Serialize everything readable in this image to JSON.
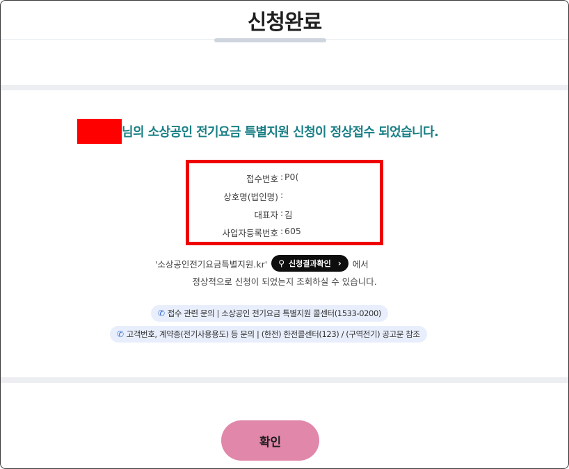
{
  "header": {
    "title": "신청완료"
  },
  "headline": {
    "text": "님의 소상공인 전기요금 특별지원 신청이 정상접수 되었습니다."
  },
  "info": {
    "rows": [
      {
        "label": "접수번호",
        "value": "P0("
      },
      {
        "label": "상호명(법인명)",
        "value": ":"
      },
      {
        "label": "대표자",
        "value": "김"
      },
      {
        "label": "사업자등록번호",
        "value": "605"
      }
    ]
  },
  "description": {
    "line1_before": "'소상공인전기요금특별지원.kr'",
    "button_label": "신청결과확인",
    "line1_after": "에서",
    "line2": "정상적으로 신청이 되었는지 조회하실 수 있습니다."
  },
  "contacts": [
    {
      "text": "접수 관련 문의 | 소상공인 전기요금 특별지원 콜센터(1533-0200)"
    },
    {
      "text": "고객번호, 계약종(전기사용용도) 등 문의 | (한전) 한전콜센터(123) / (구역전기) 공고문 참조"
    }
  ],
  "footer": {
    "confirm_label": "확인"
  },
  "colors": {
    "accent": "#1a7f86",
    "redaction": "#ff0000",
    "highlight_border": "#ee0000",
    "confirm_button": "#e187a9"
  },
  "icons": {
    "phone": "phone-icon",
    "key": "key-icon",
    "chevron": "chevron-right-icon"
  }
}
